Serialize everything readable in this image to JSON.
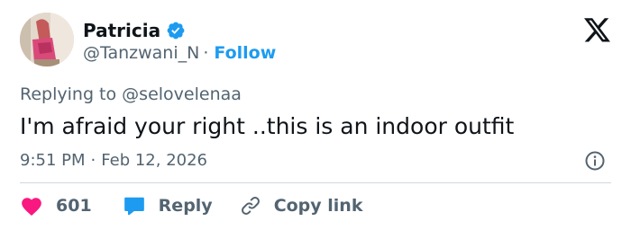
{
  "author": {
    "display_name": "Patricia",
    "handle": "@Tanzwani_N",
    "separator": "·",
    "follow_label": "Follow",
    "verified_icon": "verified-badge-icon",
    "verified_color": "#1d9bf0"
  },
  "reply_to": {
    "prefix": "Replying to",
    "mention": "@selovelenaa"
  },
  "tweet": {
    "text": "I'm afraid your right ..this is an indoor outfit",
    "time": "9:51 PM",
    "separator": "·",
    "date": "Feb 12, 2026"
  },
  "actions": {
    "like_count": "601",
    "reply_label": "Reply",
    "copy_label": "Copy link"
  },
  "colors": {
    "like": "#f91880",
    "reply": "#1d9bf0",
    "accent": "#1d9bf0",
    "secondary_text": "#536471"
  }
}
